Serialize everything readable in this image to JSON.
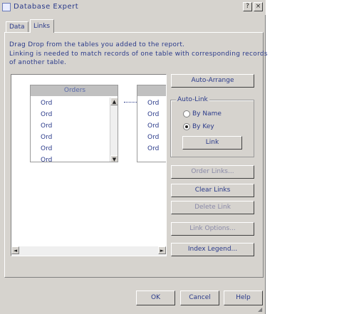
{
  "window": {
    "title": "Database Expert",
    "controls": [
      "?",
      "×"
    ]
  },
  "tabs": [
    {
      "label": "Data",
      "active": false
    },
    {
      "label": "Links",
      "active": true
    }
  ],
  "instructions": [
    "Drag Drop from the tables you added to the report.",
    "Linking is needed to match records of one table with corresponding records",
    "of another table."
  ],
  "canvas": {
    "left_table": {
      "header": "Orders",
      "fields": [
        "Ord",
        "Ord",
        "Ord",
        "Ord",
        "Ord",
        "Ord"
      ],
      "scroll_up": "▲",
      "scroll_down": "▼"
    },
    "right_table": {
      "header": "",
      "fields": [
        "Ord",
        "Ord",
        "Ord",
        "Ord",
        "Ord"
      ]
    },
    "link_arrow": "▸",
    "hscroll_left": "◄",
    "hscroll_right": "►"
  },
  "buttons": {
    "auto_arrange": "Auto-Arrange",
    "auto_link_group": "Auto-Link",
    "by_name": "By Name",
    "by_key": "By Key",
    "link": "Link",
    "order_links": "Order Links...",
    "clear_links": "Clear Links",
    "delete_link": "Delete Link",
    "link_options": "Link Options...",
    "index_legend": "Index Legend...",
    "ok": "OK",
    "cancel": "Cancel",
    "help": "Help"
  },
  "radio_state": {
    "by_name_selected": false,
    "by_key_selected": true
  }
}
